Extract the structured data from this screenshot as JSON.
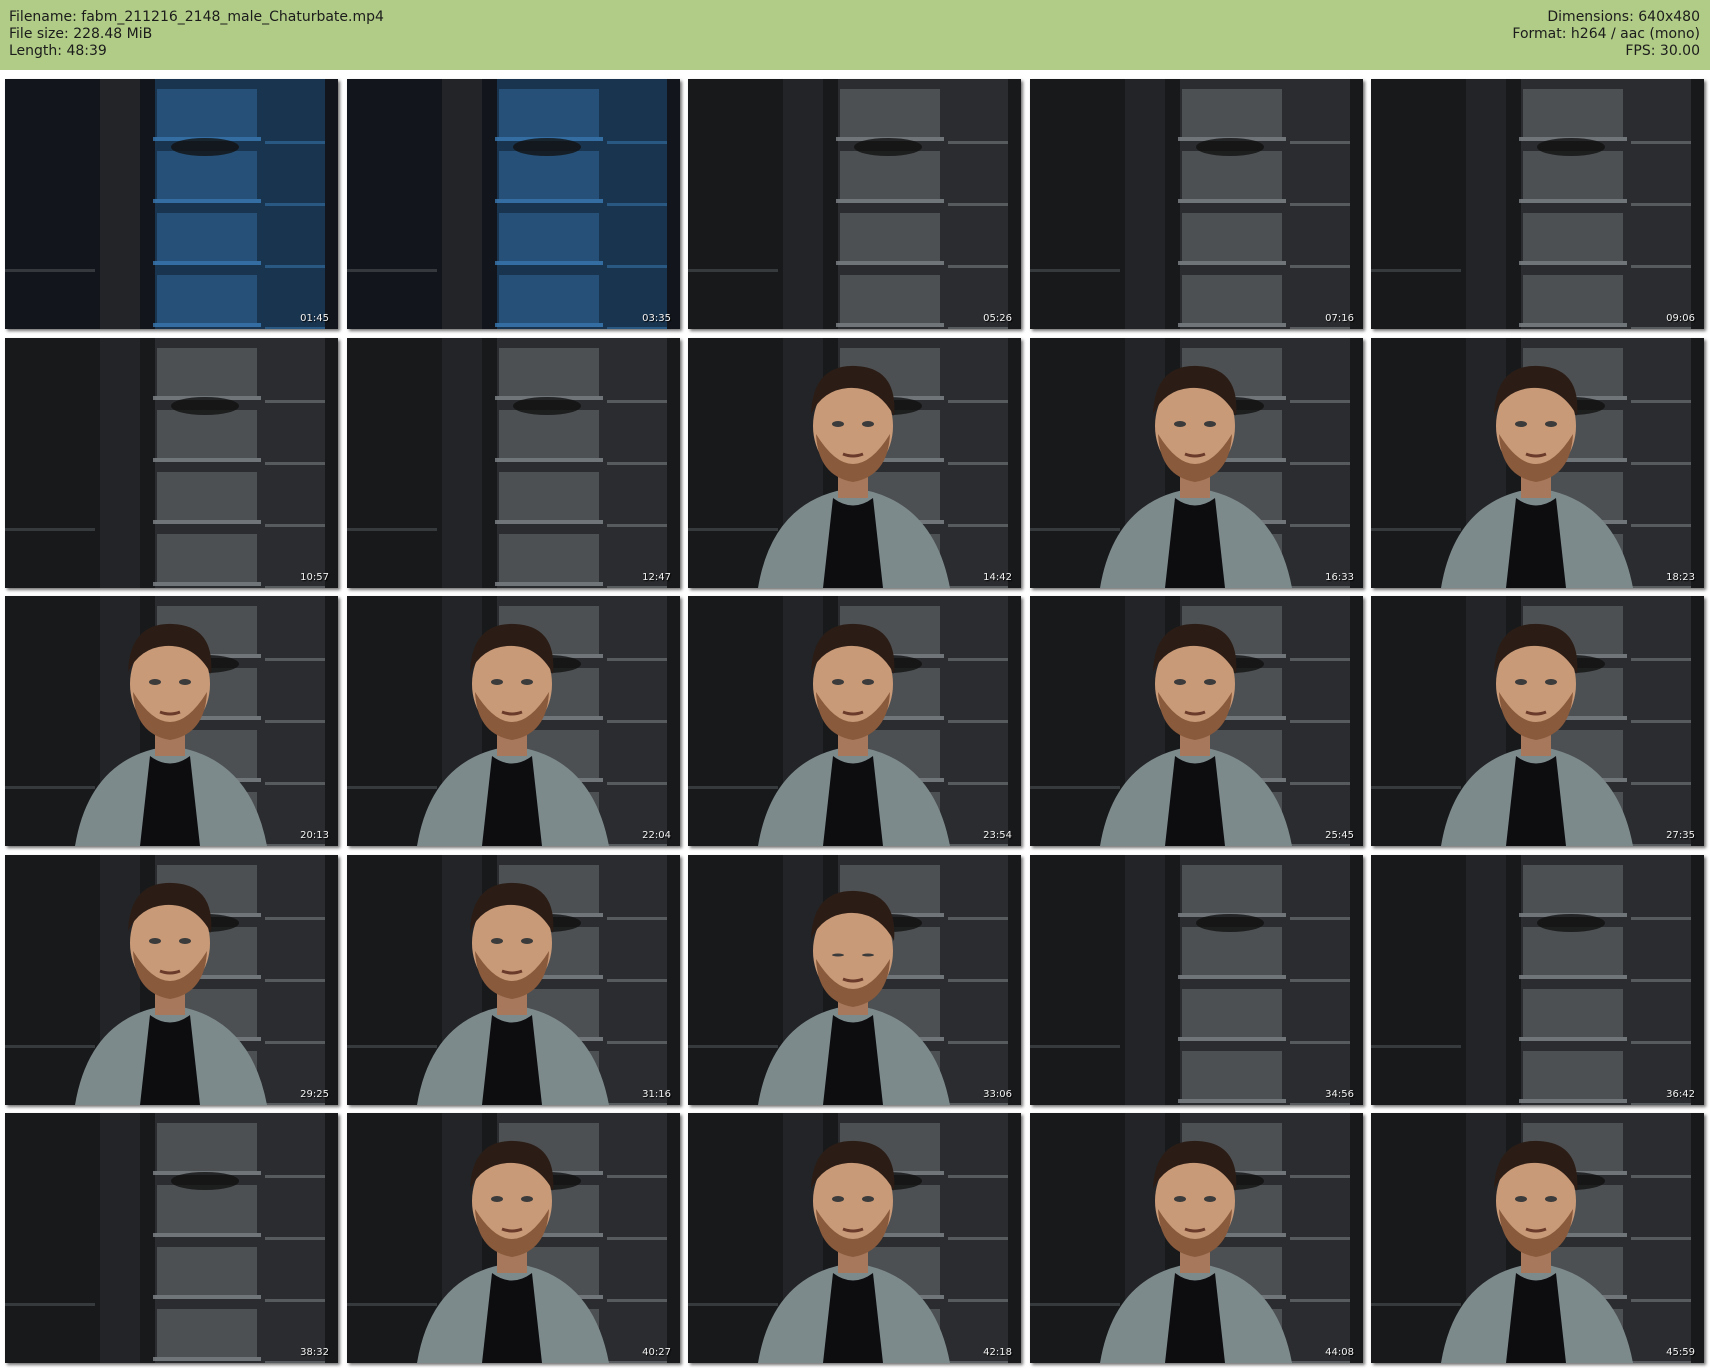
{
  "header": {
    "filename": "Filename: fabm_211216_2148_male_Chaturbate.mp4",
    "filesize": "File size: 228.48 MiB",
    "length": "Length: 48:39",
    "dimensions": "Dimensions: 640x480",
    "format": "Format: h264 / aac (mono)",
    "fps": "FPS: 30.00"
  },
  "colors": {
    "header_bg": "#b0cc86",
    "page_bg": "#ffffff"
  },
  "thumbnails": [
    {
      "time": "01:45",
      "scene": "room-blue"
    },
    {
      "time": "03:35",
      "scene": "room-blue"
    },
    {
      "time": "05:26",
      "scene": "room-dark"
    },
    {
      "time": "07:16",
      "scene": "room-dark"
    },
    {
      "time": "09:06",
      "scene": "room-dark"
    },
    {
      "time": "10:57",
      "scene": "room-dark"
    },
    {
      "time": "12:47",
      "scene": "room-dark"
    },
    {
      "time": "14:42",
      "scene": "person"
    },
    {
      "time": "16:33",
      "scene": "person"
    },
    {
      "time": "18:23",
      "scene": "person"
    },
    {
      "time": "20:13",
      "scene": "person"
    },
    {
      "time": "22:04",
      "scene": "person"
    },
    {
      "time": "23:54",
      "scene": "person"
    },
    {
      "time": "25:45",
      "scene": "person"
    },
    {
      "time": "27:35",
      "scene": "person"
    },
    {
      "time": "29:25",
      "scene": "person"
    },
    {
      "time": "31:16",
      "scene": "person"
    },
    {
      "time": "33:06",
      "scene": "person-down"
    },
    {
      "time": "34:56",
      "scene": "room-dark"
    },
    {
      "time": "36:42",
      "scene": "room-dark"
    },
    {
      "time": "38:32",
      "scene": "room-dark"
    },
    {
      "time": "40:27",
      "scene": "person"
    },
    {
      "time": "42:18",
      "scene": "person"
    },
    {
      "time": "44:08",
      "scene": "person"
    },
    {
      "time": "45:59",
      "scene": "person"
    }
  ]
}
